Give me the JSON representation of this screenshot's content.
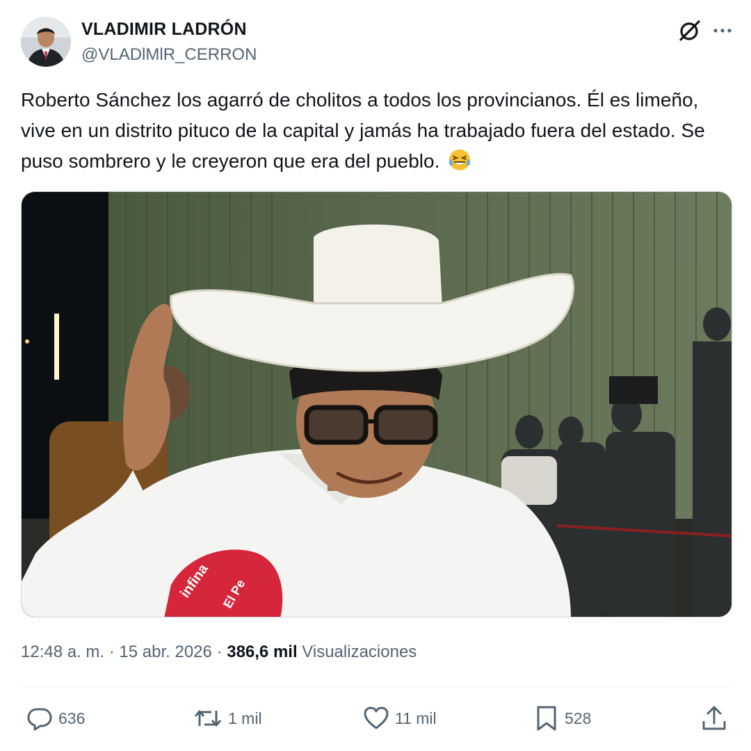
{
  "author": {
    "display_name": "VLADIMIR LADRÓN",
    "handle": "@VLADlMlR_CERRON"
  },
  "tweet": {
    "text": "Roberto Sánchez los agarró de cholitos a todos los provincianos. Él es limeño, vive en un distrito pituco de la capital y jamás ha trabajado fuera del estado. Se puso sombrero y le creyeron que era del pueblo.",
    "emoji": "face-with-tears-of-joy"
  },
  "media": {
    "microphone_text_1": "infina",
    "microphone_text_2": "El Pe"
  },
  "meta": {
    "time": "12:48 a. m.",
    "separator": "·",
    "date": "15 abr. 2026",
    "views_count": "386,6 mil",
    "views_label": "Visualizaciones"
  },
  "actions": {
    "replies": "636",
    "reposts": "1 mil",
    "likes": "11 mil",
    "bookmarks": "528"
  },
  "icons": {
    "grok": "grok-icon",
    "more": "more-options-icon",
    "reply": "reply-icon",
    "repost": "repost-icon",
    "like": "like-icon",
    "bookmark": "bookmark-icon",
    "share": "share-icon"
  },
  "colors": {
    "text_primary": "#0f1419",
    "text_secondary": "#536471",
    "border": "#cfd9de",
    "divider": "#eff3f4"
  }
}
